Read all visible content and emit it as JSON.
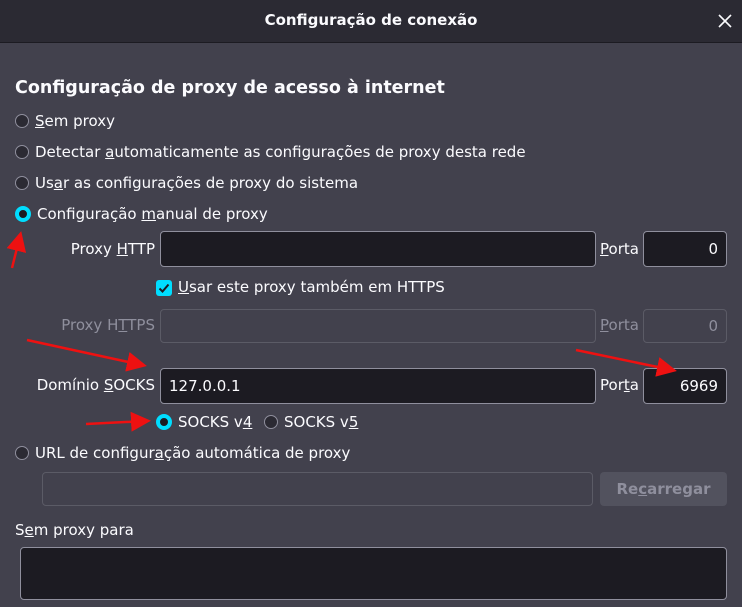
{
  "dialog": {
    "title": "Configuração de conexão"
  },
  "section": {
    "heading": "Configuração de proxy de acesso à internet"
  },
  "proxy_options": {
    "no_proxy": {
      "pre": "",
      "u": "S",
      "post": "em proxy"
    },
    "auto_detect": {
      "pre": "Detectar ",
      "u": "a",
      "post": "utomaticamente as configurações de proxy desta rede"
    },
    "system": {
      "pre": "Us",
      "u": "a",
      "post": "r as configurações de proxy do sistema"
    },
    "manual": {
      "pre": "Configuração ",
      "u": "m",
      "post": "anual de proxy"
    },
    "selected": "manual"
  },
  "http": {
    "label_pre": "Proxy ",
    "label_u": "H",
    "label_post": "TTP",
    "value": "",
    "port_label_u": "P",
    "port_label_post": "orta",
    "port_value": "0"
  },
  "https_checkbox": {
    "pre": "",
    "u": "U",
    "post": "sar este proxy também em HTTPS",
    "checked": true
  },
  "https": {
    "label_pre": "Proxy H",
    "label_u": "T",
    "label_post": "TPS",
    "value": "",
    "port_label_u": "P",
    "port_label_post": "orta",
    "port_value": "0"
  },
  "socks": {
    "label_pre": "Domínio ",
    "label_u": "S",
    "label_post": "OCKS",
    "value": "127.0.0.1",
    "port_label_pre": "Por",
    "port_label_u": "t",
    "port_label_post": "a",
    "port_value": "6969",
    "v4": {
      "pre": "SOCKS v",
      "u": "4"
    },
    "v5": {
      "pre": "SOCKS v",
      "u": "5"
    },
    "selected_version": "v4"
  },
  "pac": {
    "label_pre": "URL de configur",
    "label_u": "a",
    "label_post": "ção automática de proxy",
    "value": "",
    "reload_pre": "Re",
    "reload_u": "c",
    "reload_post": "arregar"
  },
  "no_proxy_for": {
    "label_pre": "S",
    "label_u": "e",
    "label_post": "m proxy para",
    "value": ""
  },
  "colors": {
    "background": "#42414d",
    "titlebar": "#2b2a33",
    "accent": "#00ddff",
    "annotation_arrow": "#ff0000"
  }
}
